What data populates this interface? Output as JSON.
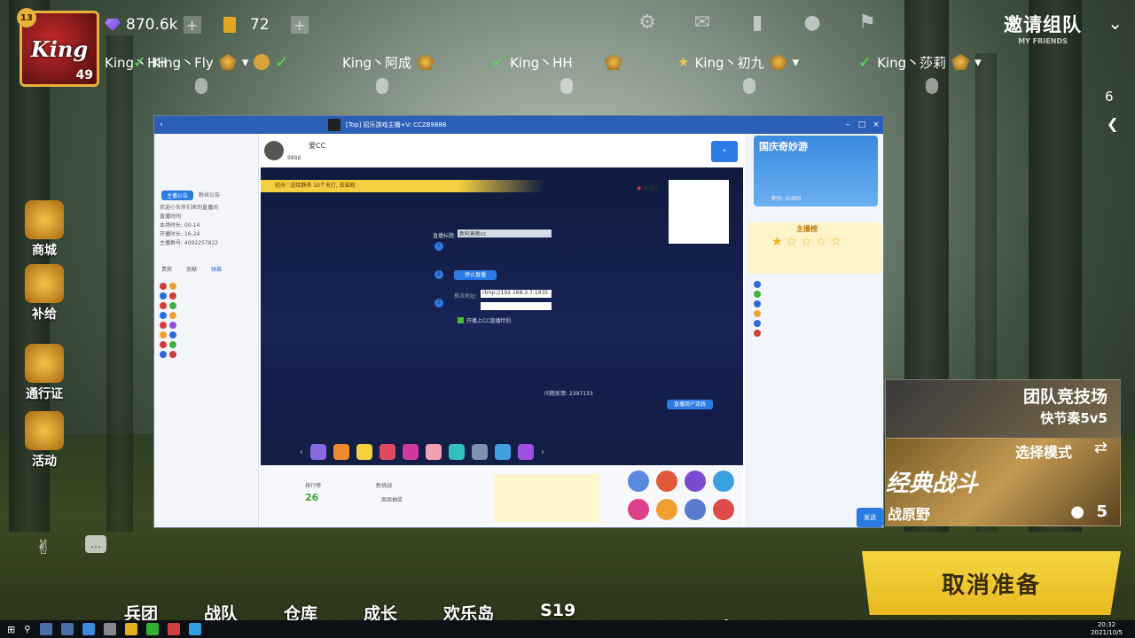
{
  "player": {
    "name": "King",
    "badge_level": "13",
    "level": "49"
  },
  "resources": {
    "diamonds": "870.6k",
    "coins": "72"
  },
  "top_icons": [
    "gear-icon",
    "mail-icon",
    "leaderboard-icon",
    "friend-icon",
    "flag-icon"
  ],
  "invite": {
    "label": "邀请组队",
    "sub": "MY FRIENDS"
  },
  "team": [
    {
      "name": "King丶HH"
    },
    {
      "name": "King丶Fly"
    },
    {
      "name": "King丶阿成"
    },
    {
      "name": "King丶HH"
    },
    {
      "name": "King丶初九"
    },
    {
      "name": "King丶莎莉"
    }
  ],
  "side_menu": [
    "商城",
    "补给",
    "通行证",
    "活动"
  ],
  "side_count": "6",
  "modes": [
    {
      "title": "团队竞技场",
      "sub": "快节奏5v5"
    },
    {
      "title": "选择模式",
      "sub": "经典战斗",
      "map": "战原野",
      "players": "5"
    }
  ],
  "cancel_ready": "取消准备",
  "bottom_nav": [
    "兵团",
    "战队",
    "仓库",
    "成长",
    "欢乐岛",
    "S19"
  ],
  "taskbar": {
    "time": "20:32",
    "date": "2021/10/5"
  },
  "stream_window": {
    "title": "[Top] 招乐游戏主播+V: CCZB9888",
    "host_name": "爱CC",
    "room_id": "9888",
    "live_status": "直播中",
    "banner": "轻舟♡送给静茶 10个天灯, 去围观",
    "stream_title_label": "直播标题:",
    "stream_title_value": "新阿景新cc",
    "start_button": "停止直播",
    "rtmp_label": "推流地址:",
    "rtmp_value": "rtmp://192.168.3.7:1935",
    "checkbox_label": "开播上CC直播伴侣",
    "feedback": "问题反馈: 2397133",
    "connect_button": "直播用户连线",
    "event_title": "国庆奇妙游",
    "event_points": "积分: 0/400",
    "rank_title": "主播榜",
    "send_button": "发送",
    "notice": {
      "title": "欢迎小伙伴们来到直播间",
      "stats": [
        "直播时间",
        "本场时长: 00-14",
        "开播时长: 16-24",
        "主播群号: 4092257822"
      ]
    },
    "left_tabs": [
      "主播公告",
      "粉丝公告"
    ],
    "chat_tabs": [
      "贵宾",
      "贡献",
      "弹幕"
    ],
    "stats": {
      "label1": "排行榜",
      "value1": "26",
      "label2": "新挑战",
      "label3": "周周抽奖"
    }
  }
}
